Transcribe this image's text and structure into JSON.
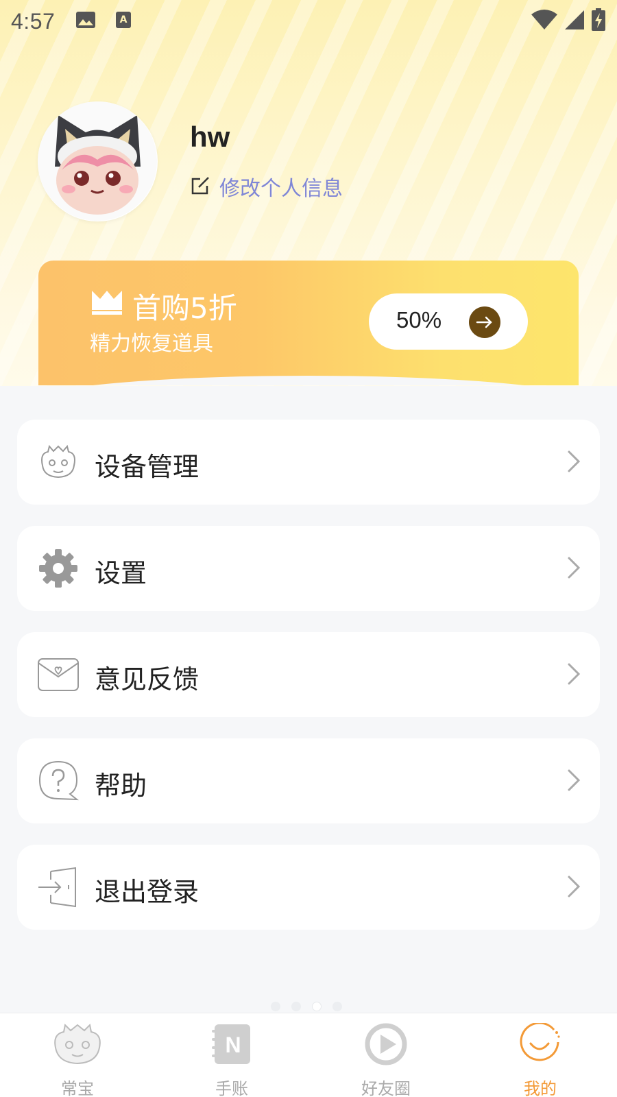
{
  "status_bar": {
    "time": "4:57",
    "left_icons": [
      "image-icon",
      "keyboard-a-icon"
    ],
    "right_icons": [
      "wifi-icon",
      "cell-signal-icon",
      "battery-charging-icon"
    ]
  },
  "profile": {
    "username": "hw",
    "edit_label": "修改个人信息",
    "avatar": "avatar-husky-dragon-icon"
  },
  "promo": {
    "title": "首购5折",
    "subtitle": "精力恢复道具",
    "pill_value": "50%",
    "icon": "crown-icon",
    "colors": {
      "start": "#fcc26a",
      "end": "#fde56c",
      "arrow_bg": "#6b4a12"
    }
  },
  "menu": [
    {
      "label": "设备管理",
      "icon": "dragon-face-icon"
    },
    {
      "label": "设置",
      "icon": "gear-icon"
    },
    {
      "label": "意见反馈",
      "icon": "envelope-heart-icon"
    },
    {
      "label": "帮助",
      "icon": "question-bubble-icon"
    },
    {
      "label": "退出登录",
      "icon": "logout-door-icon"
    }
  ],
  "tabs": [
    {
      "label": "常宝",
      "icon": "dragon-face-icon",
      "active": false
    },
    {
      "label": "手账",
      "icon": "notebook-n-icon",
      "active": false
    },
    {
      "label": "好友圈",
      "icon": "play-circle-icon",
      "active": false
    },
    {
      "label": "我的",
      "icon": "smile-circle-icon",
      "active": true
    }
  ],
  "colors": {
    "accent": "#f39a37",
    "link": "#7f86d6",
    "background": "#f6f7f9"
  }
}
